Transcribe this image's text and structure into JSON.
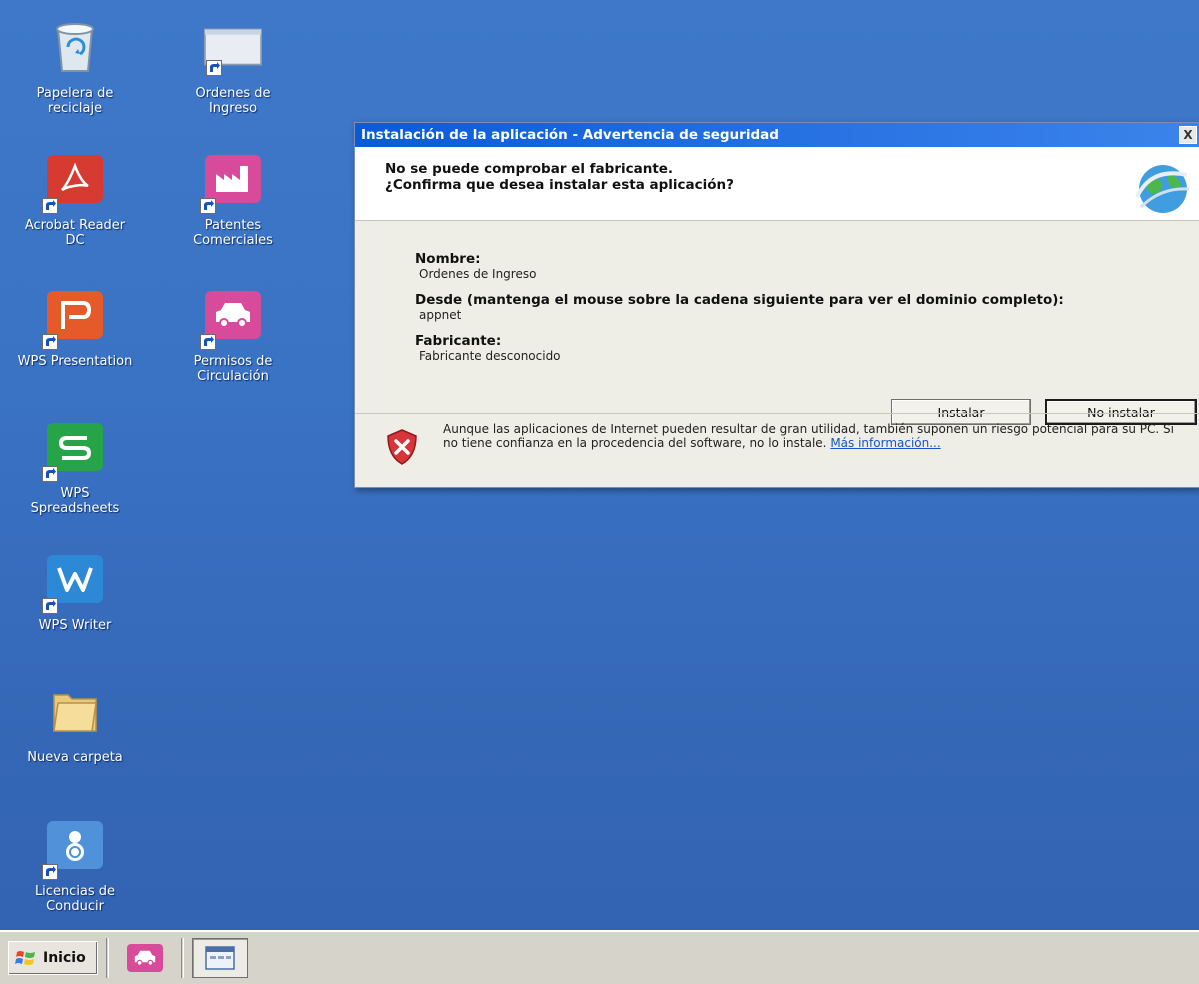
{
  "desktop": {
    "icons": [
      {
        "label": "Papelera de\nreciclaje",
        "icon": "recycle-bin-icon",
        "shortcut": false
      },
      {
        "label": "Ordenes de\nIngreso",
        "icon": "app-window-icon",
        "shortcut": true
      },
      {
        "label": "Acrobat Reader\nDC",
        "icon": "acrobat-icon",
        "shortcut": true
      },
      {
        "label": "Patentes\nComerciales",
        "icon": "factory-icon",
        "shortcut": true
      },
      {
        "label": "WPS Presentation",
        "icon": "wps-presentation-icon",
        "shortcut": true
      },
      {
        "label": "Permisos de\nCirculación",
        "icon": "car-icon",
        "shortcut": true
      },
      {
        "label": "WPS\nSpreadsheets",
        "icon": "wps-spreadsheets-icon",
        "shortcut": true
      },
      {
        "label": "WPS Writer",
        "icon": "wps-writer-icon",
        "shortcut": true
      },
      {
        "label": "Nueva carpeta",
        "icon": "folder-icon",
        "shortcut": false
      },
      {
        "label": "Licencias de\nConducir",
        "icon": "license-icon",
        "shortcut": true
      }
    ]
  },
  "dialog": {
    "title": "Instalación de la aplicación - Advertencia de seguridad",
    "close_label": "X",
    "header_line1": "No se puede comprobar el fabricante.",
    "header_line2": "¿Confirma que desea instalar esta aplicación?",
    "name_label": "Nombre:",
    "name_value": "Ordenes de Ingreso",
    "from_label": "Desde (mantenga el mouse sobre la cadena siguiente para ver el dominio completo):",
    "from_value": "appnet",
    "publisher_label": "Fabricante:",
    "publisher_value": "Fabricante desconocido",
    "install_button": "Instalar",
    "no_install_button": "No instalar",
    "warning_text": "Aunque las aplicaciones de Internet pueden resultar de gran utilidad, también suponen un riesgo potencial para su PC. Si no tiene confianza en la procedencia del software, no lo instale.",
    "more_info_link": "Más información..."
  },
  "taskbar": {
    "start_label": "Inicio",
    "buttons": [
      {
        "icon": "car-icon",
        "active": false
      },
      {
        "icon": "app-window-icon",
        "active": true
      }
    ]
  },
  "colors": {
    "desktop_bg": "#3a72c4",
    "title_bar": "#0a5bd8",
    "dialog_bg": "#eeede6",
    "taskbar_bg": "#d6d3cb",
    "link": "#1a55c4"
  }
}
